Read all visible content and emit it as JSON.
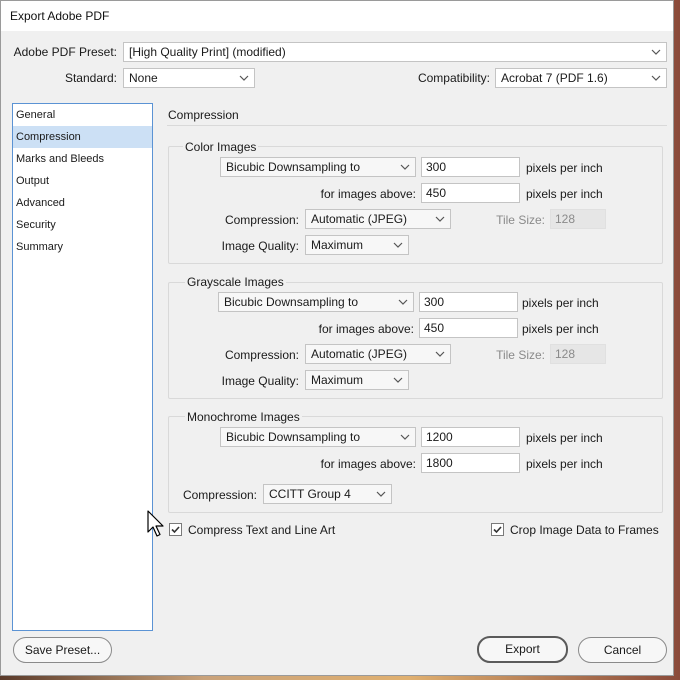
{
  "window": {
    "title": "Export Adobe PDF"
  },
  "preset": {
    "label": "Adobe PDF Preset:",
    "value": "[High Quality Print] (modified)"
  },
  "standard": {
    "label": "Standard:",
    "value": "None"
  },
  "compatibility": {
    "label": "Compatibility:",
    "value": "Acrobat 7 (PDF 1.6)"
  },
  "sidebar": {
    "items": [
      {
        "label": "General"
      },
      {
        "label": "Compression",
        "selected": true
      },
      {
        "label": "Marks and Bleeds"
      },
      {
        "label": "Output"
      },
      {
        "label": "Advanced"
      },
      {
        "label": "Security"
      },
      {
        "label": "Summary"
      }
    ]
  },
  "panel": {
    "title": "Compression"
  },
  "color_images": {
    "title": "Color Images",
    "downsampling": "Bicubic Downsampling to",
    "ppi_value": "300",
    "ppi_unit": "pixels per inch",
    "above_label": "for images above:",
    "above_value": "450",
    "above_unit": "pixels per inch",
    "compression_label": "Compression:",
    "compression_value": "Automatic (JPEG)",
    "tile_label": "Tile Size:",
    "tile_value": "128",
    "quality_label": "Image Quality:",
    "quality_value": "Maximum"
  },
  "grayscale_images": {
    "title": "Grayscale Images",
    "downsampling": "Bicubic Downsampling to",
    "ppi_value": "300",
    "ppi_unit": "pixels per inch",
    "above_label": "for images above:",
    "above_value": "450",
    "above_unit": "pixels per inch",
    "compression_label": "Compression:",
    "compression_value": "Automatic (JPEG)",
    "tile_label": "Tile Size:",
    "tile_value": "128",
    "quality_label": "Image Quality:",
    "quality_value": "Maximum"
  },
  "monochrome_images": {
    "title": "Monochrome Images",
    "downsampling": "Bicubic Downsampling to",
    "ppi_value": "1200",
    "ppi_unit": "pixels per inch",
    "above_label": "for images above:",
    "above_value": "1800",
    "above_unit": "pixels per inch",
    "compression_label": "Compression:",
    "compression_value": "CCITT Group 4"
  },
  "options": {
    "compress_text": {
      "label": "Compress Text and Line Art",
      "checked": true
    },
    "crop_image": {
      "label": "Crop Image Data to Frames",
      "checked": true
    }
  },
  "buttons": {
    "save_preset": "Save Preset...",
    "export": "Export",
    "cancel": "Cancel"
  }
}
